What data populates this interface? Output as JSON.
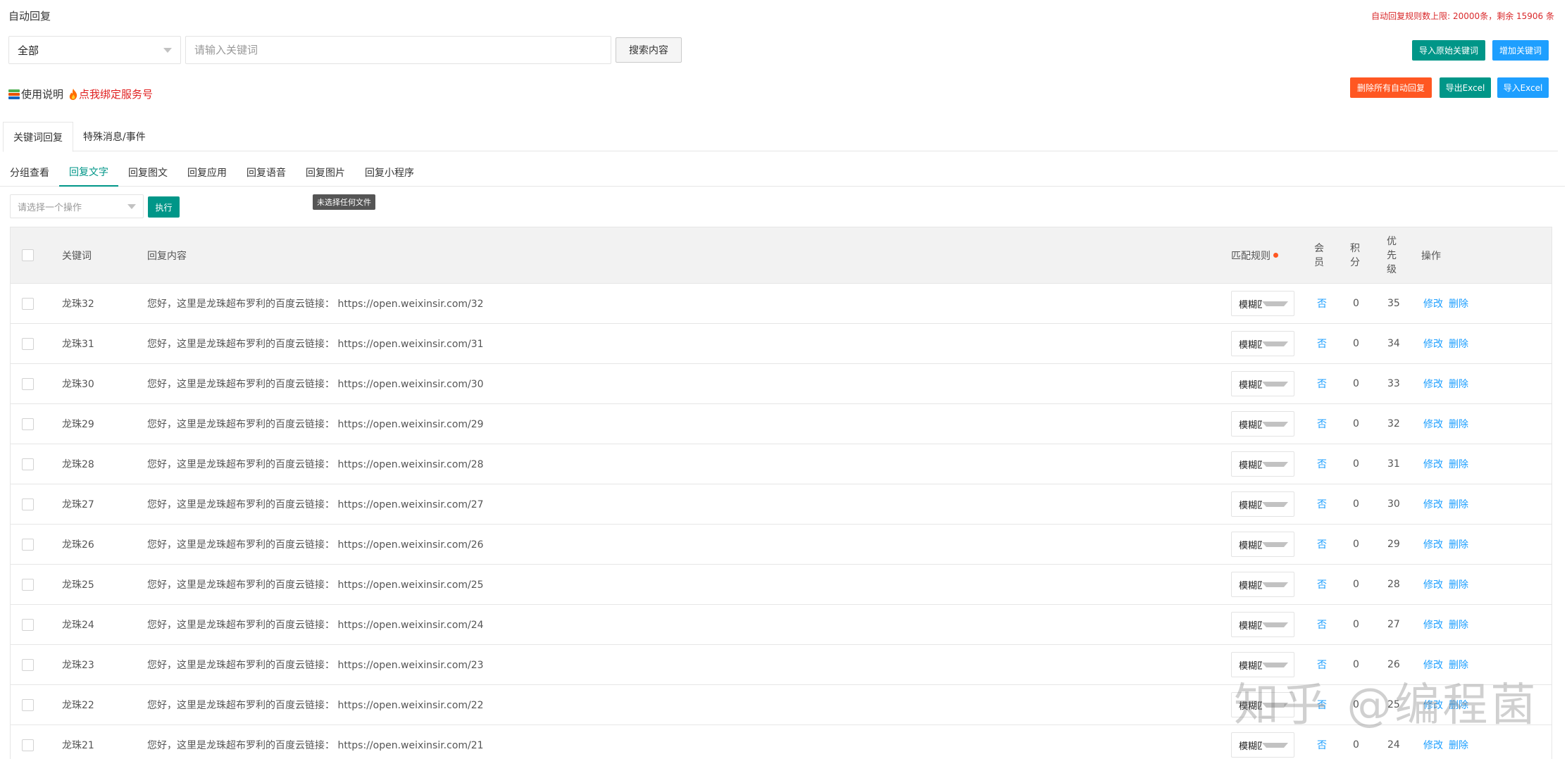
{
  "header": {
    "title": "自动回复",
    "quota_text": "自动回复规则数上限: 20000条，剩余 15906 条"
  },
  "search": {
    "group_value": "全部",
    "keyword_placeholder": "请输入关键词",
    "search_button": "搜索内容"
  },
  "buttons": {
    "import_original": "导入原始关键词",
    "add_keyword": "增加关键词",
    "delete_all": "删除所有自动回复",
    "export_excel": "导出Excel",
    "import_excel": "导入Excel"
  },
  "usage": {
    "label": "使用说明",
    "bind_link": "点我绑定服务号"
  },
  "tabs_primary": [
    "关键词回复",
    "特殊消息/事件"
  ],
  "tabs_secondary": [
    "分组查看",
    "回复文字",
    "回复图文",
    "回复应用",
    "回复语音",
    "回复图片",
    "回复小程序"
  ],
  "tooltip": "未选择任何文件",
  "bulk": {
    "placeholder": "请选择一个操作",
    "exec_button": "执行"
  },
  "table": {
    "headers": {
      "keyword": "关键词",
      "content": "回复内容",
      "match_rule": "匹配规则",
      "member": [
        "会",
        "员"
      ],
      "points": [
        "积",
        "分"
      ],
      "priority": [
        "优",
        "先",
        "级"
      ],
      "actions": "操作"
    },
    "rows": [
      {
        "keyword": "龙珠32",
        "content": "您好，这里是龙珠超布罗利的百度云链接：  https://open.weixinsir.com/32",
        "match": "模糊匹配",
        "member": "否",
        "points": "0",
        "priority": "35",
        "edit": "修改",
        "delete": "删除"
      },
      {
        "keyword": "龙珠31",
        "content": "您好，这里是龙珠超布罗利的百度云链接：  https://open.weixinsir.com/31",
        "match": "模糊匹配",
        "member": "否",
        "points": "0",
        "priority": "34",
        "edit": "修改",
        "delete": "删除"
      },
      {
        "keyword": "龙珠30",
        "content": "您好，这里是龙珠超布罗利的百度云链接：  https://open.weixinsir.com/30",
        "match": "模糊匹配",
        "member": "否",
        "points": "0",
        "priority": "33",
        "edit": "修改",
        "delete": "删除"
      },
      {
        "keyword": "龙珠29",
        "content": "您好，这里是龙珠超布罗利的百度云链接：  https://open.weixinsir.com/29",
        "match": "模糊匹配",
        "member": "否",
        "points": "0",
        "priority": "32",
        "edit": "修改",
        "delete": "删除"
      },
      {
        "keyword": "龙珠28",
        "content": "您好，这里是龙珠超布罗利的百度云链接：  https://open.weixinsir.com/28",
        "match": "模糊匹配",
        "member": "否",
        "points": "0",
        "priority": "31",
        "edit": "修改",
        "delete": "删除"
      },
      {
        "keyword": "龙珠27",
        "content": "您好，这里是龙珠超布罗利的百度云链接：  https://open.weixinsir.com/27",
        "match": "模糊匹配",
        "member": "否",
        "points": "0",
        "priority": "30",
        "edit": "修改",
        "delete": "删除"
      },
      {
        "keyword": "龙珠26",
        "content": "您好，这里是龙珠超布罗利的百度云链接：  https://open.weixinsir.com/26",
        "match": "模糊匹配",
        "member": "否",
        "points": "0",
        "priority": "29",
        "edit": "修改",
        "delete": "删除"
      },
      {
        "keyword": "龙珠25",
        "content": "您好，这里是龙珠超布罗利的百度云链接：  https://open.weixinsir.com/25",
        "match": "模糊匹配",
        "member": "否",
        "points": "0",
        "priority": "28",
        "edit": "修改",
        "delete": "删除"
      },
      {
        "keyword": "龙珠24",
        "content": "您好，这里是龙珠超布罗利的百度云链接：  https://open.weixinsir.com/24",
        "match": "模糊匹配",
        "member": "否",
        "points": "0",
        "priority": "27",
        "edit": "修改",
        "delete": "删除"
      },
      {
        "keyword": "龙珠23",
        "content": "您好，这里是龙珠超布罗利的百度云链接：  https://open.weixinsir.com/23",
        "match": "模糊匹配",
        "member": "否",
        "points": "0",
        "priority": "26",
        "edit": "修改",
        "delete": "删除"
      },
      {
        "keyword": "龙珠22",
        "content": "您好，这里是龙珠超布罗利的百度云链接：  https://open.weixinsir.com/22",
        "match": "模糊匹配",
        "member": "否",
        "points": "0",
        "priority": "25",
        "edit": "修改",
        "delete": "删除"
      },
      {
        "keyword": "龙珠21",
        "content": "您好，这里是龙珠超布罗利的百度云链接：  https://open.weixinsir.com/21",
        "match": "模糊匹配",
        "member": "否",
        "points": "0",
        "priority": "24",
        "edit": "修改",
        "delete": "删除"
      }
    ]
  },
  "watermark": "知乎 @编程菌"
}
